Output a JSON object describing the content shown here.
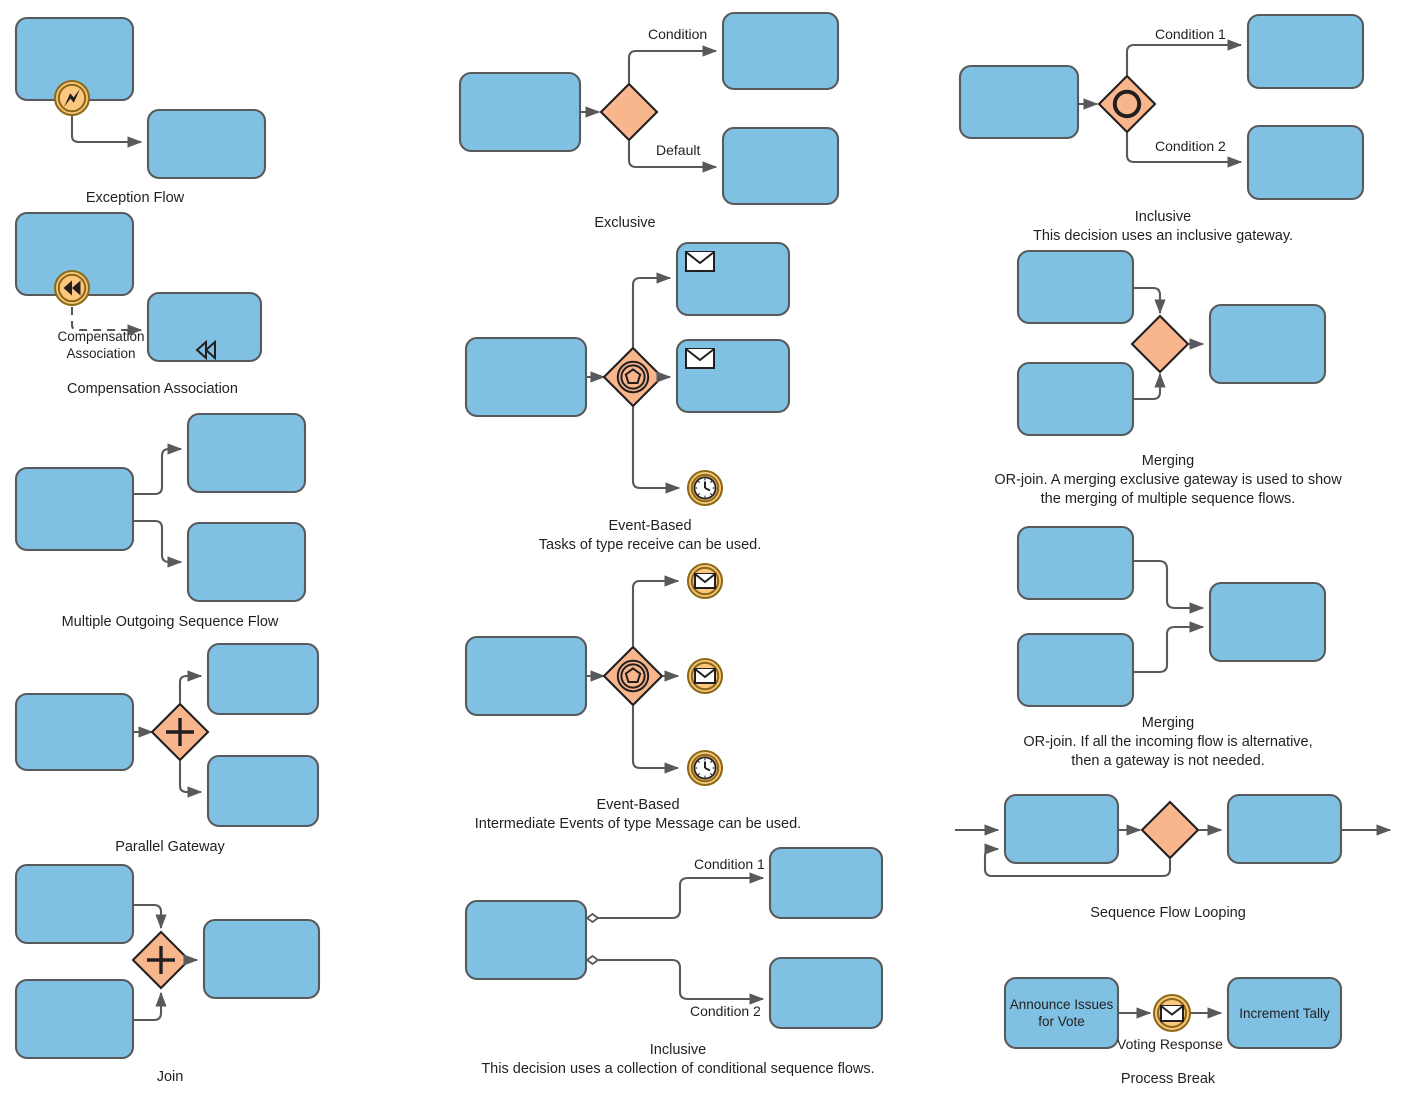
{
  "theme": {
    "task_fill": "#80C1E3",
    "task_stroke": "#58595b",
    "gateway_fill": "#F9B68D",
    "gateway_stroke": "#231f20",
    "event_fill": "#FBC87D",
    "event_stroke": "#8c6a18",
    "flow_stroke": "#58595b",
    "text_color": "#231f20",
    "background": "#ffffff"
  },
  "sections": [
    {
      "id": "exception-flow",
      "caption": "Exception Flow",
      "icons": [
        "error-event-icon"
      ]
    },
    {
      "id": "compensation-association",
      "caption": "Compensation Association",
      "edge_label": "Compensation\nAssociation",
      "icons": [
        "compensation-event-icon",
        "compensation-marker-icon"
      ]
    },
    {
      "id": "multiple-outgoing-sequence-flow",
      "caption": "Multiple Outgoing Sequence Flow",
      "icons": []
    },
    {
      "id": "parallel-gateway",
      "caption": "Parallel Gateway",
      "icons": [
        "parallel-gateway-plus-icon"
      ]
    },
    {
      "id": "join",
      "caption": "Join",
      "icons": [
        "parallel-gateway-plus-icon"
      ]
    },
    {
      "id": "exclusive",
      "caption": "Exclusive",
      "edge_labels": [
        "Condition",
        "Default"
      ],
      "icons": [
        "exclusive-gateway-icon"
      ]
    },
    {
      "id": "event-based-receive",
      "caption": "Event-Based\nTasks of type receive can be used.",
      "icons": [
        "event-based-gateway-icon",
        "message-marker-icon",
        "timer-event-icon"
      ]
    },
    {
      "id": "event-based-message",
      "caption": "Event-Based\nIntermediate Events of type Message can be used.",
      "icons": [
        "event-based-gateway-icon",
        "message-event-icon",
        "timer-event-icon"
      ]
    },
    {
      "id": "inclusive-conditional-flows",
      "caption": "Inclusive\nThis decision uses a collection of conditional sequence flows.",
      "edge_labels": [
        "Condition 1",
        "Condition 2"
      ],
      "icons": [
        "conditional-flow-diamond-icon"
      ]
    },
    {
      "id": "inclusive-gateway",
      "caption": "Inclusive\nThis decision uses an inclusive gateway.",
      "edge_labels": [
        "Condition 1",
        "Condition 2"
      ],
      "icons": [
        "inclusive-gateway-icon"
      ]
    },
    {
      "id": "merging-exclusive",
      "caption": "Merging\nOR-join. A merging exclusive gateway is used to show\nthe merging of multiple sequence flows.",
      "icons": [
        "exclusive-gateway-icon"
      ]
    },
    {
      "id": "merging-no-gateway",
      "caption": "Merging\nOR-join. If all the incoming flow is alternative,\nthen a gateway is not needed.",
      "icons": []
    },
    {
      "id": "sequence-flow-looping",
      "caption": "Sequence Flow Looping",
      "icons": [
        "exclusive-gateway-icon"
      ]
    },
    {
      "id": "process-break",
      "caption": "Process Break",
      "tasks": [
        "Announce Issues\nfor Vote",
        "Increment Tally"
      ],
      "edge_label": "Voting Response",
      "icons": [
        "message-event-icon"
      ]
    }
  ],
  "captions": {
    "exception_flow": "Exception Flow",
    "compensation_association": "Compensation Association",
    "compensation_association_edge": "Compensation\nAssociation",
    "multiple_outgoing": "Multiple Outgoing Sequence Flow",
    "parallel_gateway": "Parallel Gateway",
    "join": "Join",
    "exclusive": "Exclusive",
    "exclusive_cond": "Condition",
    "exclusive_default": "Default",
    "event_based_receive_l1": "Event-Based",
    "event_based_receive_l2": "Tasks of type receive can be used.",
    "event_based_msg_l1": "Event-Based",
    "event_based_msg_l2": "Intermediate Events of type Message can be used.",
    "inclusive_cond_l1": "Inclusive",
    "inclusive_cond_l2": "This decision uses a collection of conditional sequence flows.",
    "cond_1": "Condition 1",
    "cond_2": "Condition 2",
    "inclusive_gw_l1": "Inclusive",
    "inclusive_gw_l2": "This decision uses an inclusive gateway.",
    "inc_cond_1": "Condition 1",
    "inc_cond_2": "Condition 2",
    "merging_a_l1": "Merging",
    "merging_a_l2": "OR-join. A merging exclusive gateway is used to show",
    "merging_a_l3": "the merging of multiple sequence flows.",
    "merging_b_l1": "Merging",
    "merging_b_l2": "OR-join. If all the incoming flow is alternative,",
    "merging_b_l3": "then a gateway is not needed.",
    "sequence_flow_looping": "Sequence Flow Looping",
    "process_break": "Process Break",
    "pb_task1": "Announce Issues\nfor Vote",
    "pb_task2": "Increment Tally",
    "pb_edge": "Voting Response"
  }
}
